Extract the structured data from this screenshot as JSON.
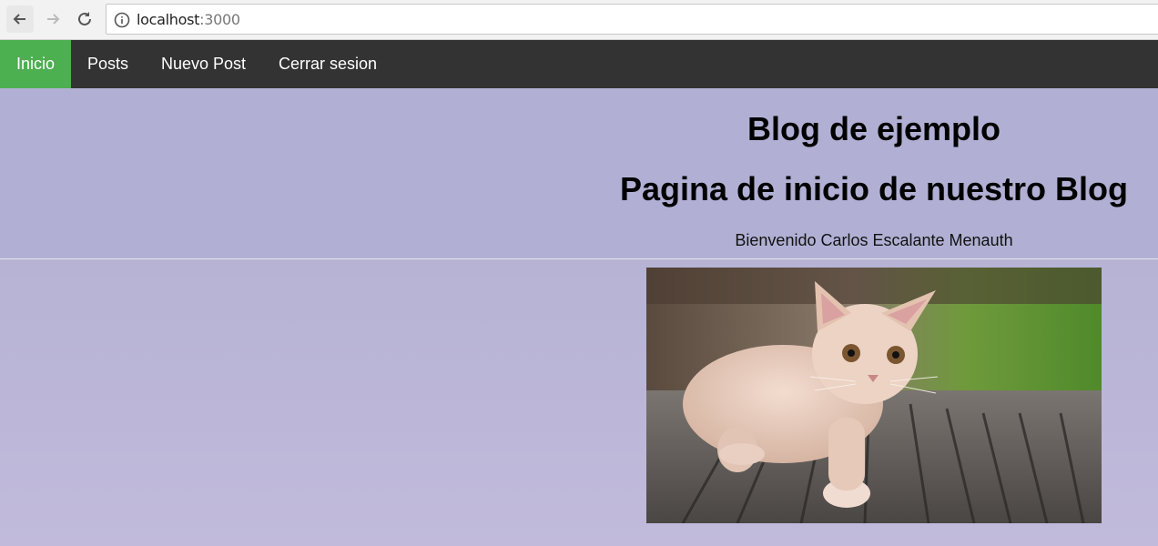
{
  "browser": {
    "url_host": "localhost",
    "url_port": ":3000"
  },
  "navbar": {
    "items": [
      {
        "label": "Inicio",
        "active": true
      },
      {
        "label": "Posts",
        "active": false
      },
      {
        "label": "Nuevo Post",
        "active": false
      },
      {
        "label": "Cerrar sesion",
        "active": false
      }
    ]
  },
  "header": {
    "title": "Blog de ejemplo",
    "subtitle": "Pagina de inicio de nuestro Blog",
    "welcome": "Bienvenido Carlos Escalante Menauth"
  },
  "colors": {
    "active_nav": "#4caf50",
    "navbar_bg": "#333333",
    "page_bg": "#b1b0d4"
  },
  "image": {
    "icon": "kitten-photo"
  }
}
